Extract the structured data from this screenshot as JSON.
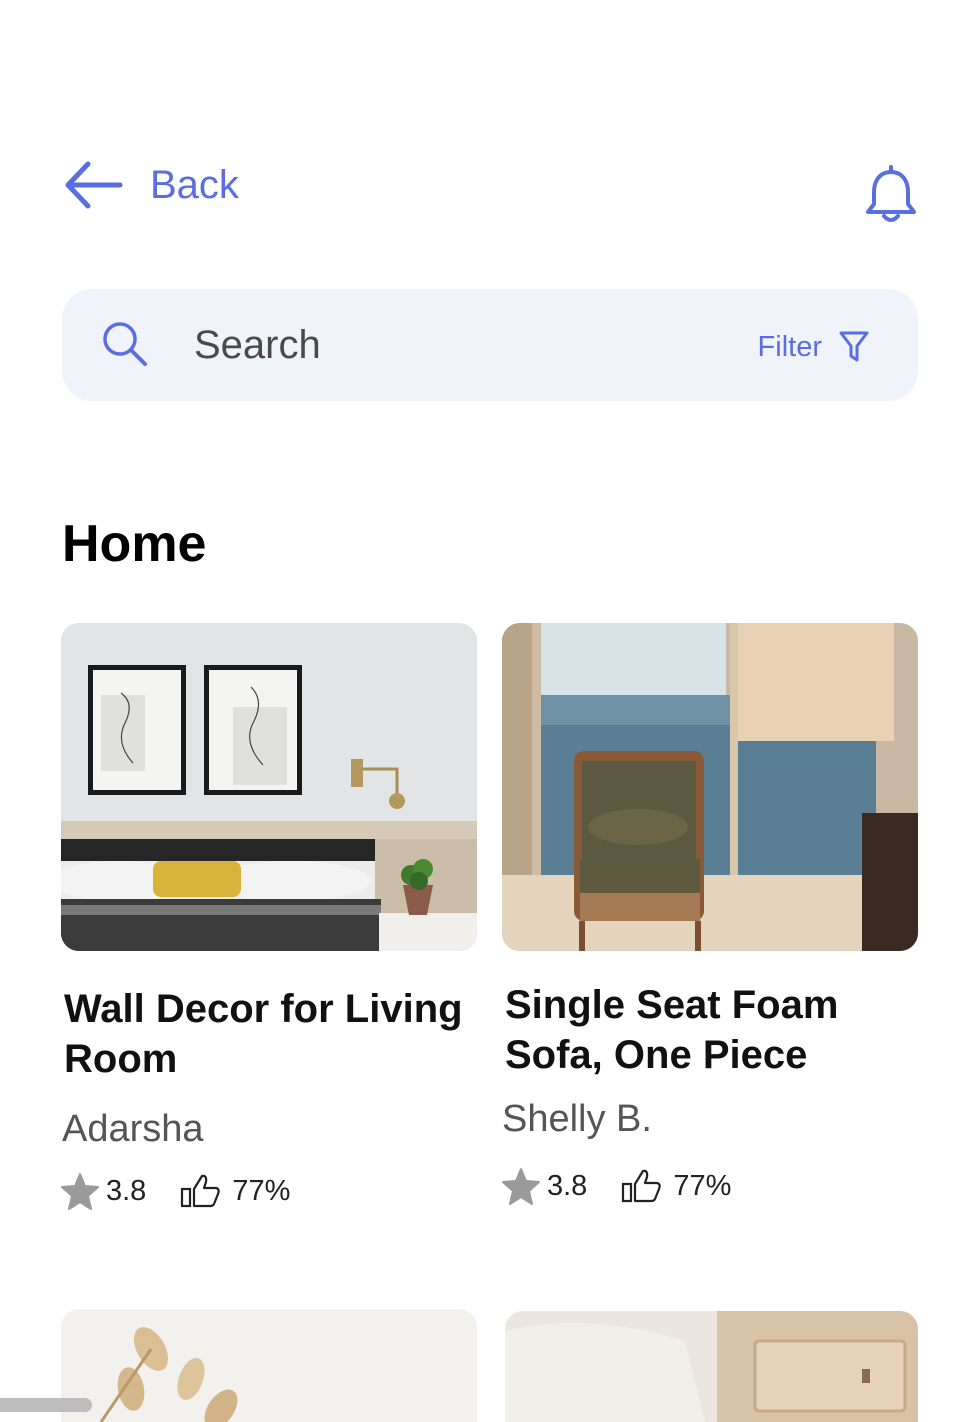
{
  "header": {
    "back_label": "Back"
  },
  "search": {
    "placeholder": "Search",
    "filter_label": "Filter"
  },
  "section": {
    "title": "Home"
  },
  "products": [
    {
      "title": "Wall Decor for Living Room",
      "author": "Adarsha",
      "rating": "3.8",
      "likes": "77%"
    },
    {
      "title": "Single Seat Foam Sofa, One Piece",
      "author": "Shelly B.",
      "rating": "3.8",
      "likes": "77%"
    }
  ],
  "colors": {
    "accent": "#5b6ee1",
    "search_bg": "#f0f3f9",
    "icon_gray": "#9a9a9a"
  }
}
